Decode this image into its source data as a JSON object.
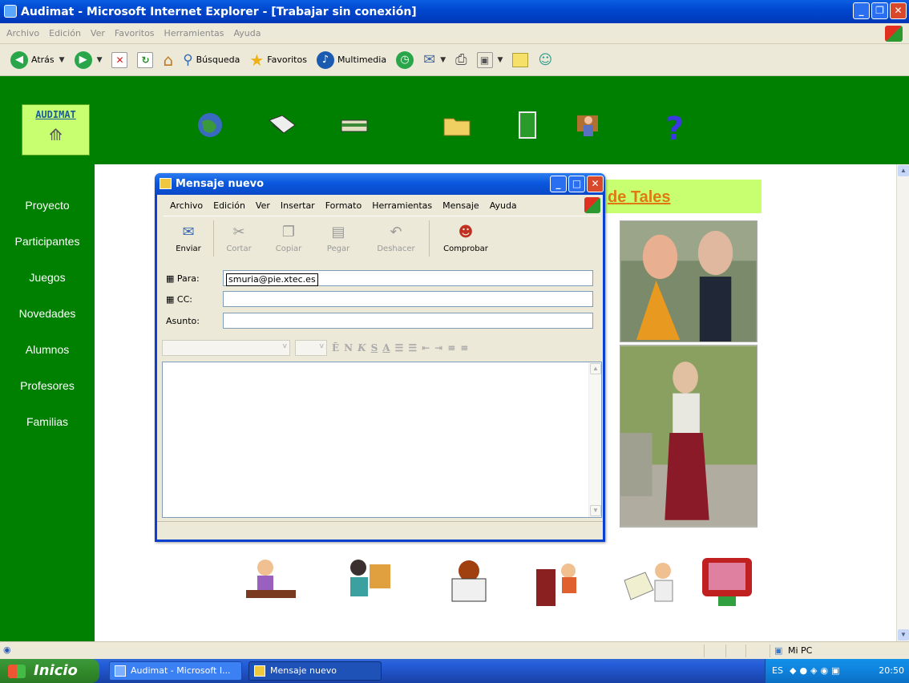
{
  "ie": {
    "title": "Audimat - Microsoft Internet Explorer - [Trabajar sin conexión]",
    "menu": [
      "Archivo",
      "Edición",
      "Ver",
      "Favoritos",
      "Herramientas",
      "Ayuda"
    ],
    "toolbar": {
      "back": "Atrás",
      "search": "Búsqueda",
      "favorites": "Favoritos",
      "media": "Multimedia"
    },
    "status_zone": "Mi PC"
  },
  "site": {
    "logo": "AUDIMAT",
    "nav": [
      "Proyecto",
      "Participantes",
      "Juegos",
      "Novedades",
      "Alumnos",
      "Profesores",
      "Familias"
    ],
    "title_partial": "de Tales"
  },
  "mail": {
    "title": "Mensaje nuevo",
    "menu": [
      "Archivo",
      "Edición",
      "Ver",
      "Insertar",
      "Formato",
      "Herramientas",
      "Mensaje",
      "Ayuda"
    ],
    "tools": {
      "send": "Enviar",
      "cut": "Cortar",
      "copy": "Copiar",
      "paste": "Pegar",
      "undo": "Deshacer",
      "check": "Comprobar"
    },
    "to_label": "Para:",
    "to_value": "smuria@pie.xtec.es",
    "cc_label": "CC:",
    "cc_value": "",
    "subject_label": "Asunto:",
    "subject_value": "",
    "body": ""
  },
  "taskbar": {
    "start": "Inicio",
    "tasks": [
      "Audimat - Microsoft I...",
      "Mensaje nuevo"
    ],
    "lang": "ES",
    "time": "20:50"
  }
}
